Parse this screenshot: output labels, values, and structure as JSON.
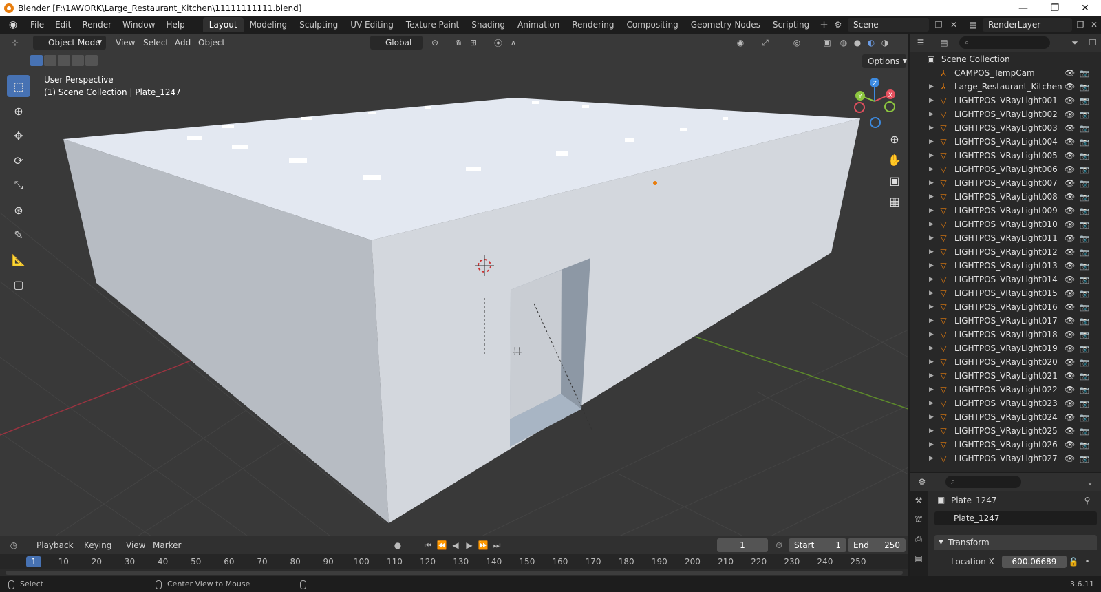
{
  "window": {
    "title": "Blender [F:\\1AWORK\\Large_Restaurant_Kitchen\\11111111111.blend]",
    "minimize": "—",
    "maximize": "❐",
    "close": "✕"
  },
  "menu": {
    "items": [
      "File",
      "Edit",
      "Render",
      "Window",
      "Help"
    ]
  },
  "workspaces": {
    "tabs": [
      "Layout",
      "Modeling",
      "Sculpting",
      "UV Editing",
      "Texture Paint",
      "Shading",
      "Animation",
      "Rendering",
      "Compositing",
      "Geometry Nodes",
      "Scripting"
    ],
    "active": "Layout",
    "add": "+"
  },
  "scene": {
    "name": "Scene",
    "view_layer": "RenderLayer"
  },
  "viewport": {
    "mode": "Object Mode",
    "menus": [
      "View",
      "Select",
      "Add",
      "Object"
    ],
    "transform_orientation": "Global",
    "options_label": "Options",
    "perspective_label": "User Perspective",
    "collection_label": "(1) Scene Collection | Plate_1247",
    "gizmo": {
      "z": "Z",
      "y": "Y",
      "x": "X"
    }
  },
  "outliner": {
    "root": "Scene Collection",
    "items": [
      {
        "name": "CAMPOS_TempCam",
        "type": "empty"
      },
      {
        "name": "Large_Restaurant_Kitchen",
        "type": "empty"
      },
      {
        "name": "LIGHTPOS_VRayLight001",
        "type": "mesh"
      },
      {
        "name": "LIGHTPOS_VRayLight002",
        "type": "mesh"
      },
      {
        "name": "LIGHTPOS_VRayLight003",
        "type": "mesh"
      },
      {
        "name": "LIGHTPOS_VRayLight004",
        "type": "mesh"
      },
      {
        "name": "LIGHTPOS_VRayLight005",
        "type": "mesh"
      },
      {
        "name": "LIGHTPOS_VRayLight006",
        "type": "mesh"
      },
      {
        "name": "LIGHTPOS_VRayLight007",
        "type": "mesh"
      },
      {
        "name": "LIGHTPOS_VRayLight008",
        "type": "mesh"
      },
      {
        "name": "LIGHTPOS_VRayLight009",
        "type": "mesh"
      },
      {
        "name": "LIGHTPOS_VRayLight010",
        "type": "mesh"
      },
      {
        "name": "LIGHTPOS_VRayLight011",
        "type": "mesh"
      },
      {
        "name": "LIGHTPOS_VRayLight012",
        "type": "mesh"
      },
      {
        "name": "LIGHTPOS_VRayLight013",
        "type": "mesh"
      },
      {
        "name": "LIGHTPOS_VRayLight014",
        "type": "mesh"
      },
      {
        "name": "LIGHTPOS_VRayLight015",
        "type": "mesh"
      },
      {
        "name": "LIGHTPOS_VRayLight016",
        "type": "mesh"
      },
      {
        "name": "LIGHTPOS_VRayLight017",
        "type": "mesh"
      },
      {
        "name": "LIGHTPOS_VRayLight018",
        "type": "mesh"
      },
      {
        "name": "LIGHTPOS_VRayLight019",
        "type": "mesh"
      },
      {
        "name": "LIGHTPOS_VRayLight020",
        "type": "mesh"
      },
      {
        "name": "LIGHTPOS_VRayLight021",
        "type": "mesh"
      },
      {
        "name": "LIGHTPOS_VRayLight022",
        "type": "mesh"
      },
      {
        "name": "LIGHTPOS_VRayLight023",
        "type": "mesh"
      },
      {
        "name": "LIGHTPOS_VRayLight024",
        "type": "mesh"
      },
      {
        "name": "LIGHTPOS_VRayLight025",
        "type": "mesh"
      },
      {
        "name": "LIGHTPOS_VRayLight026",
        "type": "mesh"
      },
      {
        "name": "LIGHTPOS_VRayLight027",
        "type": "mesh"
      }
    ]
  },
  "properties": {
    "object_name": "Plate_1247",
    "data_name": "Plate_1247",
    "panel": "Transform",
    "location_x_label": "Location X",
    "location_x_value": "600.06689"
  },
  "timeline": {
    "menus": [
      "Playback",
      "Keying",
      "View",
      "Marker"
    ],
    "current_frame": "1",
    "start_label": "Start",
    "start_value": "1",
    "end_label": "End",
    "end_value": "250",
    "ruler": [
      "1",
      "10",
      "20",
      "30",
      "40",
      "50",
      "60",
      "70",
      "80",
      "90",
      "100",
      "110",
      "120",
      "130",
      "140",
      "150",
      "160",
      "170",
      "180",
      "190",
      "200",
      "210",
      "220",
      "230",
      "240",
      "250"
    ]
  },
  "status": {
    "select": "Select",
    "center_view": "Center View to Mouse",
    "version": "3.6.11"
  },
  "colors": {
    "accent": "#4772b3",
    "orange": "#e87d0d",
    "axis_x": "#e4505e",
    "axis_y": "#8cc63f",
    "axis_z": "#3d8be0"
  }
}
